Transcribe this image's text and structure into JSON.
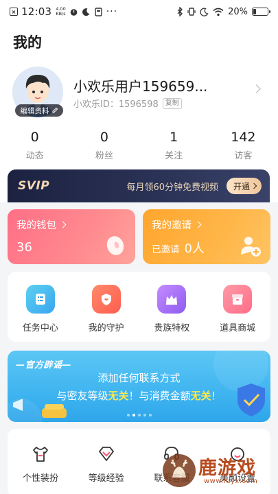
{
  "status_bar": {
    "time": "12:03",
    "speed_value": "4.00",
    "speed_unit": "KB/s",
    "battery": "20%",
    "battery_level": 0.2
  },
  "page_title": "我的",
  "profile": {
    "username": "小欢乐用户159659...",
    "user_id": "小欢乐ID：1596598",
    "copy_label": "复制",
    "edit_label": "编辑资料"
  },
  "stats": [
    {
      "value": "0",
      "label": "动态"
    },
    {
      "value": "0",
      "label": "粉丝"
    },
    {
      "value": "1",
      "label": "关注"
    },
    {
      "value": "142",
      "label": "访客"
    }
  ],
  "svip": {
    "logo": "SVIP",
    "promo_text": "每月领60分钟免费视频",
    "button_label": "开通"
  },
  "wallet": {
    "title": "我的钱包",
    "value": "36"
  },
  "invite": {
    "title": "我的邀请",
    "prefix": "已邀请",
    "count": "0人"
  },
  "tools": [
    {
      "label": "任务中心",
      "icon": "task-icon"
    },
    {
      "label": "我的守护",
      "icon": "guard-icon"
    },
    {
      "label": "贵族特权",
      "icon": "crown-icon"
    },
    {
      "label": "道具商城",
      "icon": "shop-icon"
    }
  ],
  "banner": {
    "tag": "—官方辟谣—",
    "line1": "添加任何联系方式",
    "line2_a": "与密友等级",
    "line2_b": "无关",
    "line2_c": "！与消费金额",
    "line2_d": "无关",
    "line2_e": "！",
    "page_count": 5,
    "active_page": 1
  },
  "bottom_items": [
    {
      "label": "个性装扮",
      "icon": "shirt-icon"
    },
    {
      "label": "等级经验",
      "icon": "diamond-icon"
    },
    {
      "label": "联系客服",
      "icon": "headset-icon"
    },
    {
      "label": "美颜设置",
      "icon": "beauty-icon"
    }
  ],
  "watermark": {
    "text": "鹿游戏",
    "url": "www.luyx.com"
  },
  "colors": {
    "wallet_card": "#ff7688",
    "invite_card": "#ffb040",
    "svip_bg": "#232a4a",
    "banner_bg": "#3fb4f0",
    "highlight": "#ffe94a"
  }
}
